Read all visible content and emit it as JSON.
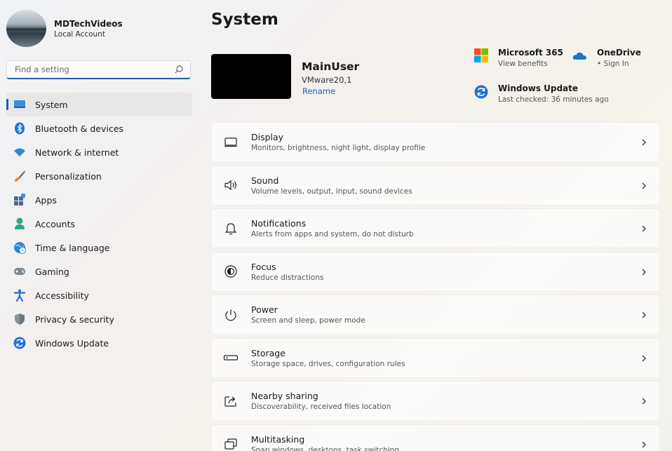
{
  "profile": {
    "name": "MDTechVideos",
    "account_type": "Local Account"
  },
  "search": {
    "placeholder": "Find a setting"
  },
  "nav": [
    {
      "label": "System",
      "icon": "monitor-icon",
      "active": true
    },
    {
      "label": "Bluetooth & devices",
      "icon": "bluetooth-icon"
    },
    {
      "label": "Network & internet",
      "icon": "wifi-icon"
    },
    {
      "label": "Personalization",
      "icon": "brush-icon"
    },
    {
      "label": "Apps",
      "icon": "apps-icon"
    },
    {
      "label": "Accounts",
      "icon": "person-icon"
    },
    {
      "label": "Time & language",
      "icon": "globe-clock-icon"
    },
    {
      "label": "Gaming",
      "icon": "gamepad-icon"
    },
    {
      "label": "Accessibility",
      "icon": "accessibility-icon"
    },
    {
      "label": "Privacy & security",
      "icon": "shield-icon"
    },
    {
      "label": "Windows Update",
      "icon": "update-icon"
    }
  ],
  "page": {
    "title": "System"
  },
  "device": {
    "name": "MainUser",
    "model": "VMware20,1",
    "rename_label": "Rename"
  },
  "quick_links": {
    "microsoft365": {
      "title": "Microsoft 365",
      "subtitle": "View benefits"
    },
    "onedrive": {
      "title": "OneDrive",
      "subtitle": "• Sign In"
    },
    "windows_update": {
      "title": "Windows Update",
      "subtitle": "Last checked: 36 minutes ago"
    }
  },
  "cards": [
    {
      "title": "Display",
      "subtitle": "Monitors, brightness, night light, display profile",
      "icon": "display-icon"
    },
    {
      "title": "Sound",
      "subtitle": "Volume levels, output, input, sound devices",
      "icon": "speaker-icon"
    },
    {
      "title": "Notifications",
      "subtitle": "Alerts from apps and system, do not disturb",
      "icon": "bell-icon"
    },
    {
      "title": "Focus",
      "subtitle": "Reduce distractions",
      "icon": "focus-icon"
    },
    {
      "title": "Power",
      "subtitle": "Screen and sleep, power mode",
      "icon": "power-icon"
    },
    {
      "title": "Storage",
      "subtitle": "Storage space, drives, configuration rules",
      "icon": "storage-icon"
    },
    {
      "title": "Nearby sharing",
      "subtitle": "Discoverability, received files location",
      "icon": "share-icon"
    },
    {
      "title": "Multitasking",
      "subtitle": "Snap windows, desktops, task switching",
      "icon": "multitasking-icon"
    }
  ],
  "colors": {
    "accent": "#1f5fa8"
  }
}
